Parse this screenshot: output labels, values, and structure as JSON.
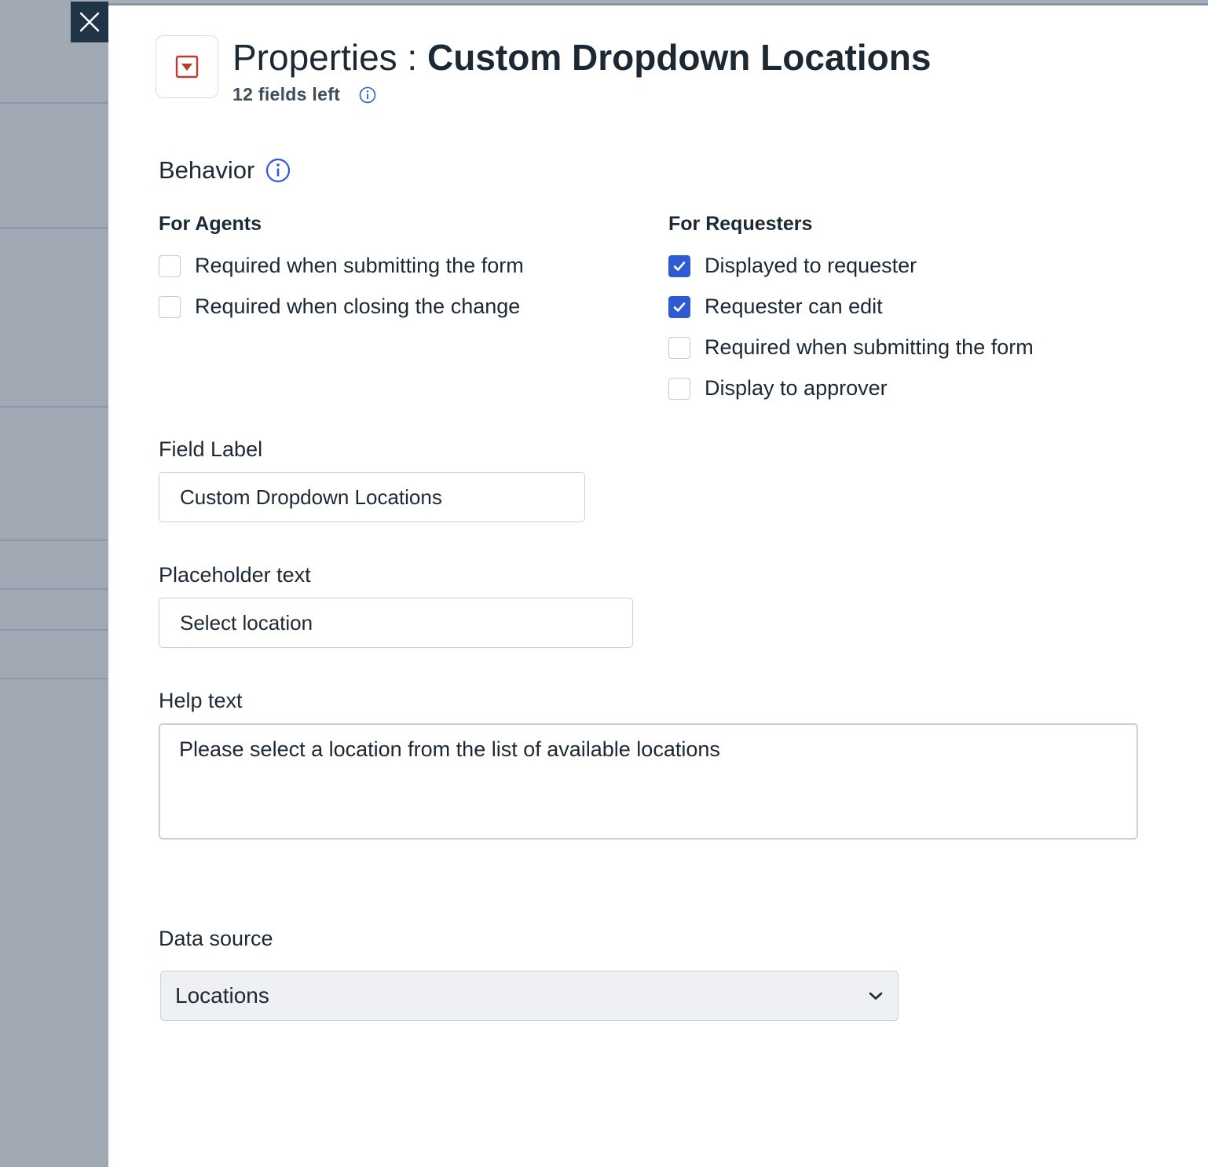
{
  "header": {
    "title_prefix": "Properties : ",
    "title_name": "Custom Dropdown Locations",
    "fields_left": "12 fields left"
  },
  "behavior": {
    "title": "Behavior",
    "agents": {
      "title": "For Agents",
      "options": [
        {
          "label": "Required when submitting the form",
          "checked": false
        },
        {
          "label": "Required when closing the change",
          "checked": false
        }
      ]
    },
    "requesters": {
      "title": "For Requesters",
      "options": [
        {
          "label": "Displayed to requester",
          "checked": true
        },
        {
          "label": "Requester can edit",
          "checked": true
        },
        {
          "label": "Required when submitting the form",
          "checked": false
        },
        {
          "label": "Display to approver",
          "checked": false
        }
      ]
    }
  },
  "form": {
    "field_label": {
      "label": "Field Label",
      "value": "Custom Dropdown Locations"
    },
    "placeholder_text": {
      "label": "Placeholder text",
      "value": "Select location"
    },
    "help_text": {
      "label": "Help text",
      "value": "Please select a location from the list of available locations"
    },
    "data_source": {
      "label": "Data source",
      "value": "Locations"
    }
  },
  "colors": {
    "accent": "#2e5ad6",
    "icon_red": "#c0392b",
    "close_bg": "#1f3446"
  }
}
